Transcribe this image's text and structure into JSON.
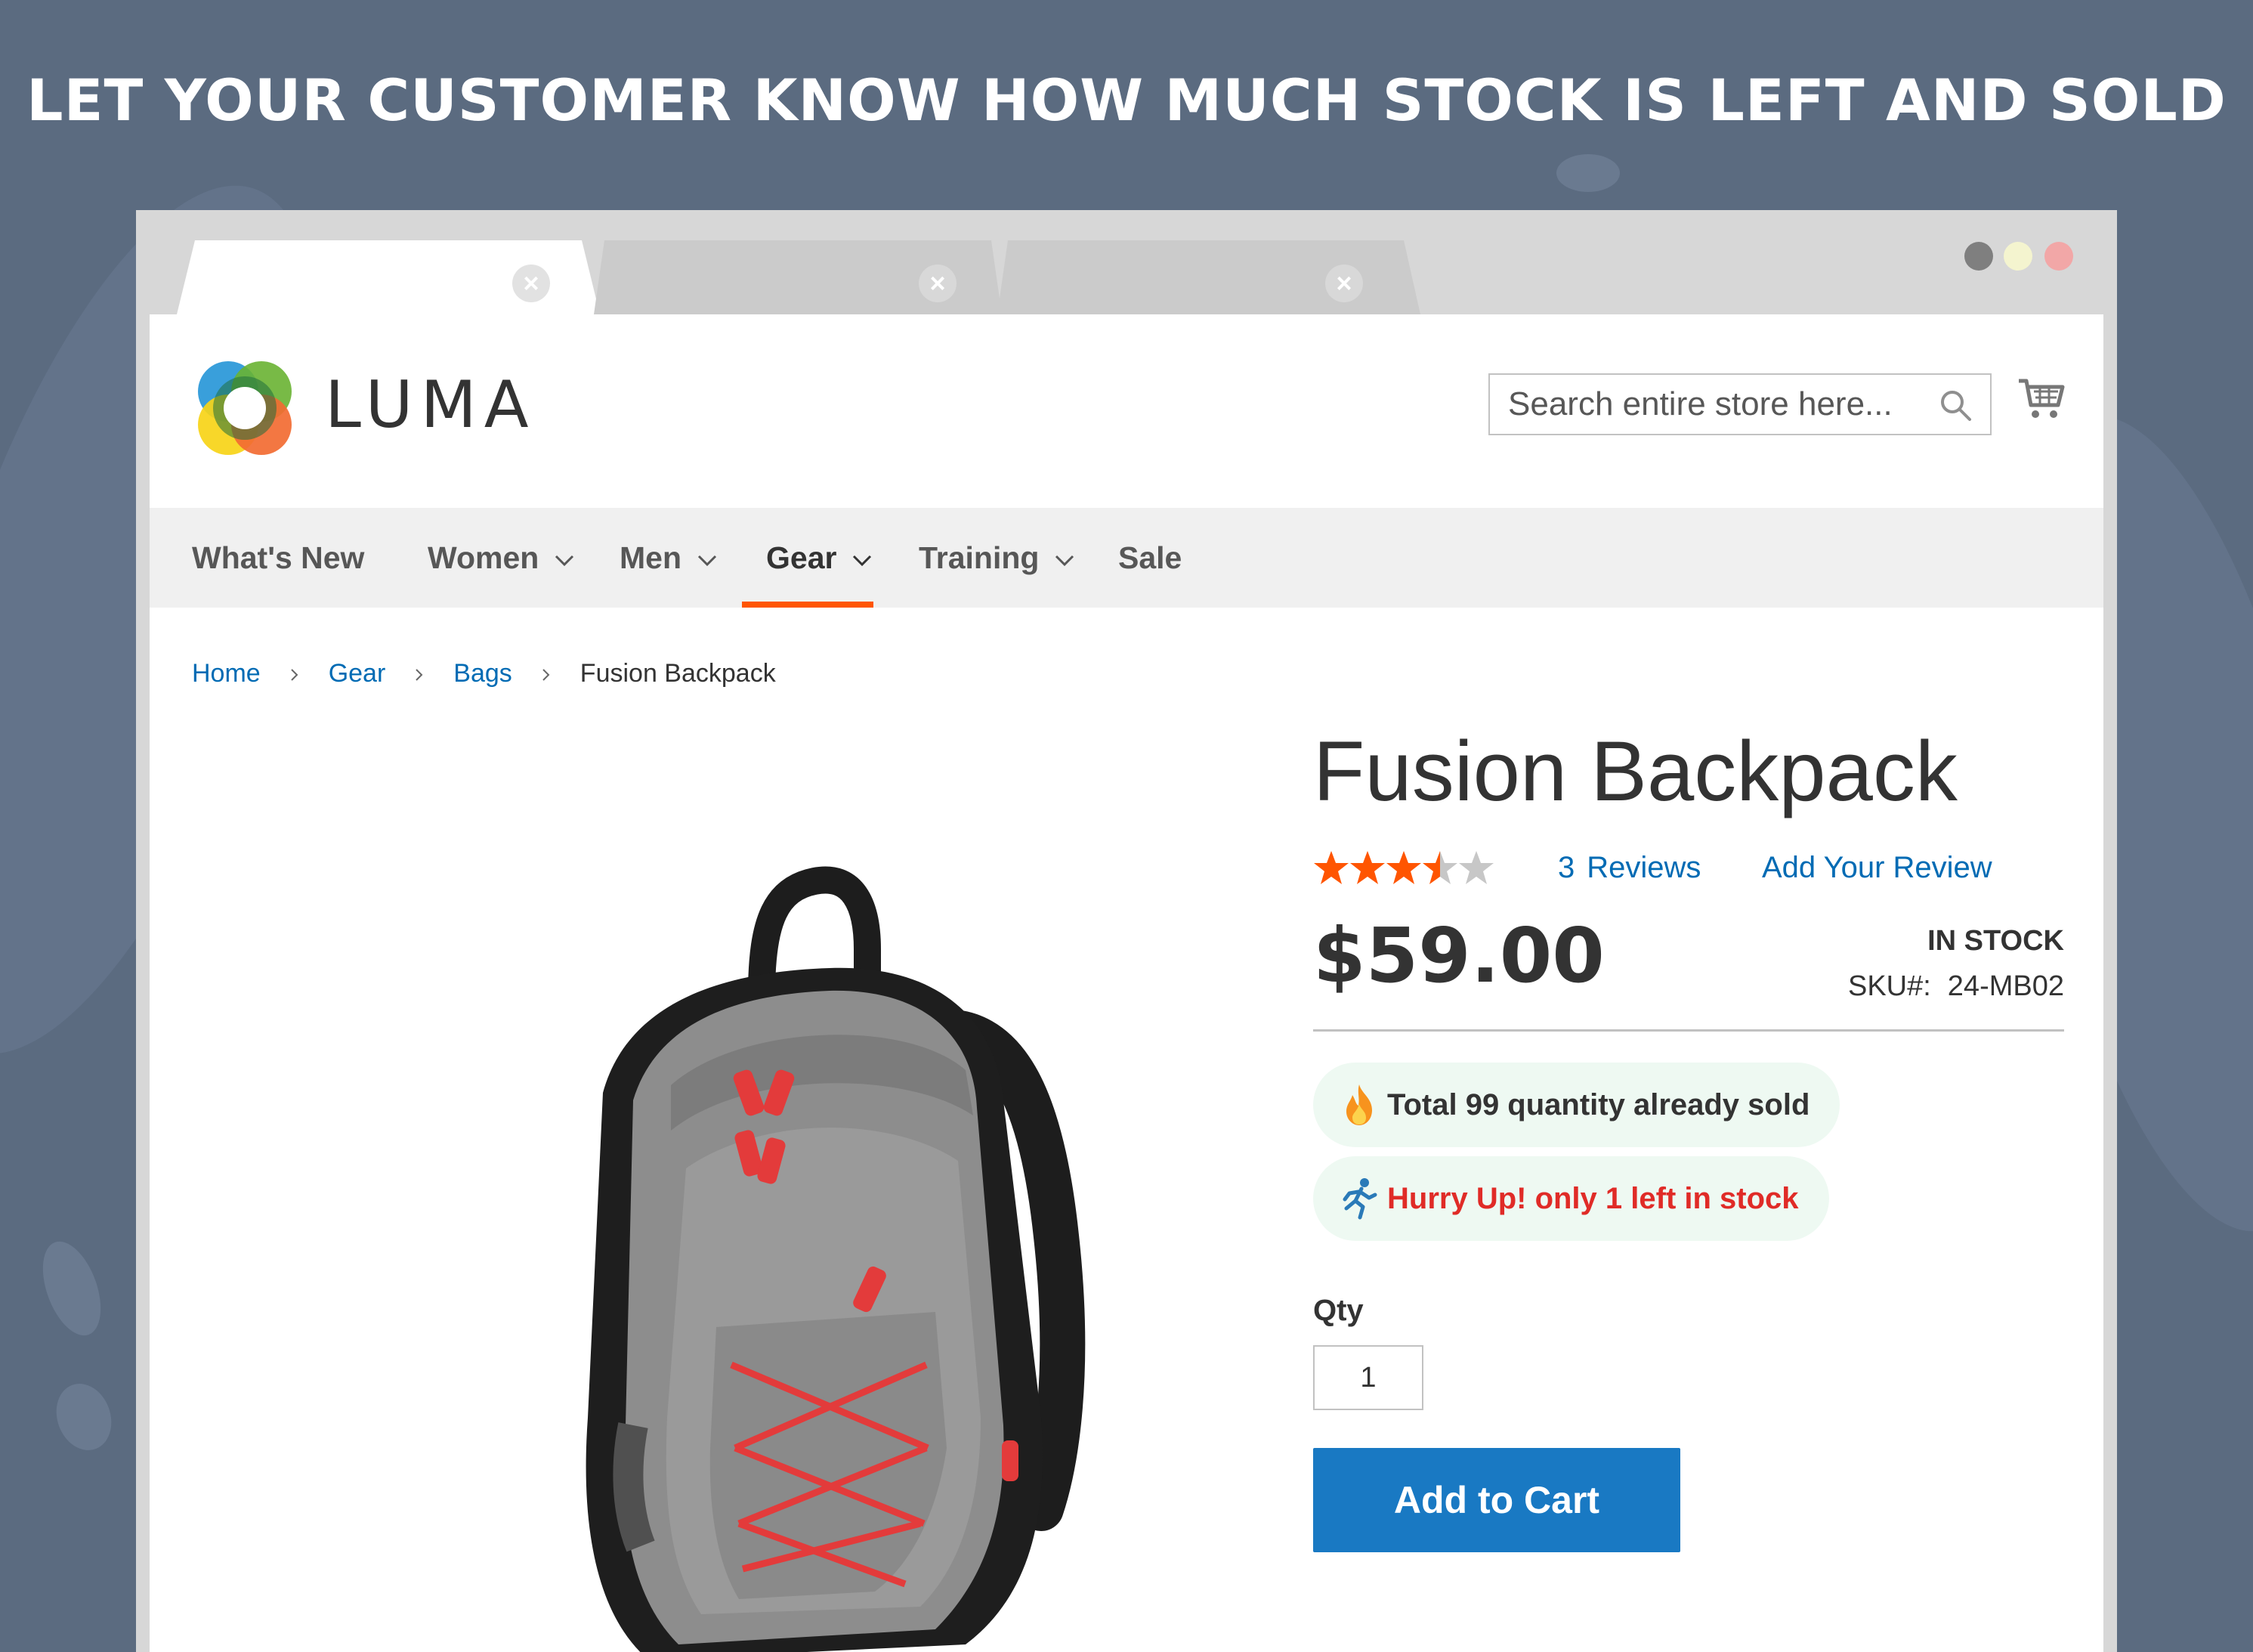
{
  "banner": {
    "headline": "LET YOUR CUSTOMER KNOW HOW MUCH STOCK IS LEFT AND SOLD"
  },
  "browser": {
    "tabs": [
      {
        "state": "active",
        "close_icon": "close-icon"
      },
      {
        "state": "inactive",
        "close_icon": "close-icon"
      },
      {
        "state": "inactive",
        "close_icon": "close-icon"
      }
    ],
    "window_controls": [
      "#7f7f7f",
      "#f4f4cf",
      "#f2a7a7"
    ]
  },
  "store": {
    "logo_text": "LUMA",
    "search": {
      "placeholder": "Search entire store here...",
      "value": "",
      "icon": "search-icon"
    },
    "cart_icon": "cart-icon"
  },
  "nav": {
    "items": [
      {
        "label": "What's New",
        "has_dropdown": false,
        "active": false
      },
      {
        "label": "Women",
        "has_dropdown": true,
        "active": false
      },
      {
        "label": "Men",
        "has_dropdown": true,
        "active": false
      },
      {
        "label": "Gear",
        "has_dropdown": true,
        "active": true
      },
      {
        "label": "Training",
        "has_dropdown": true,
        "active": false
      },
      {
        "label": "Sale",
        "has_dropdown": false,
        "active": false
      }
    ],
    "active_color": "#ff5501"
  },
  "breadcrumb": {
    "links": [
      "Home",
      "Gear",
      "Bags"
    ],
    "current": "Fusion Backpack"
  },
  "product": {
    "title": "Fusion Backpack",
    "rating": {
      "value": 3.5,
      "max": 5,
      "color": "#ff5501"
    },
    "reviews_count": "3",
    "reviews_label": "Reviews",
    "add_review": "Add Your Review",
    "price": "$59.00",
    "stock_status": "IN STOCK",
    "sku_label": "SKU#:",
    "sku_value": "24-MB02",
    "sold_message": "Total 99 quantity already sold",
    "left_message": "Hurry Up! only 1 left in stock",
    "sold_icon": "fire-icon",
    "left_icon": "running-person-icon",
    "qty_label": "Qty",
    "qty_value": "1",
    "add_to_cart": "Add to Cart",
    "button_color": "#1979c3"
  }
}
